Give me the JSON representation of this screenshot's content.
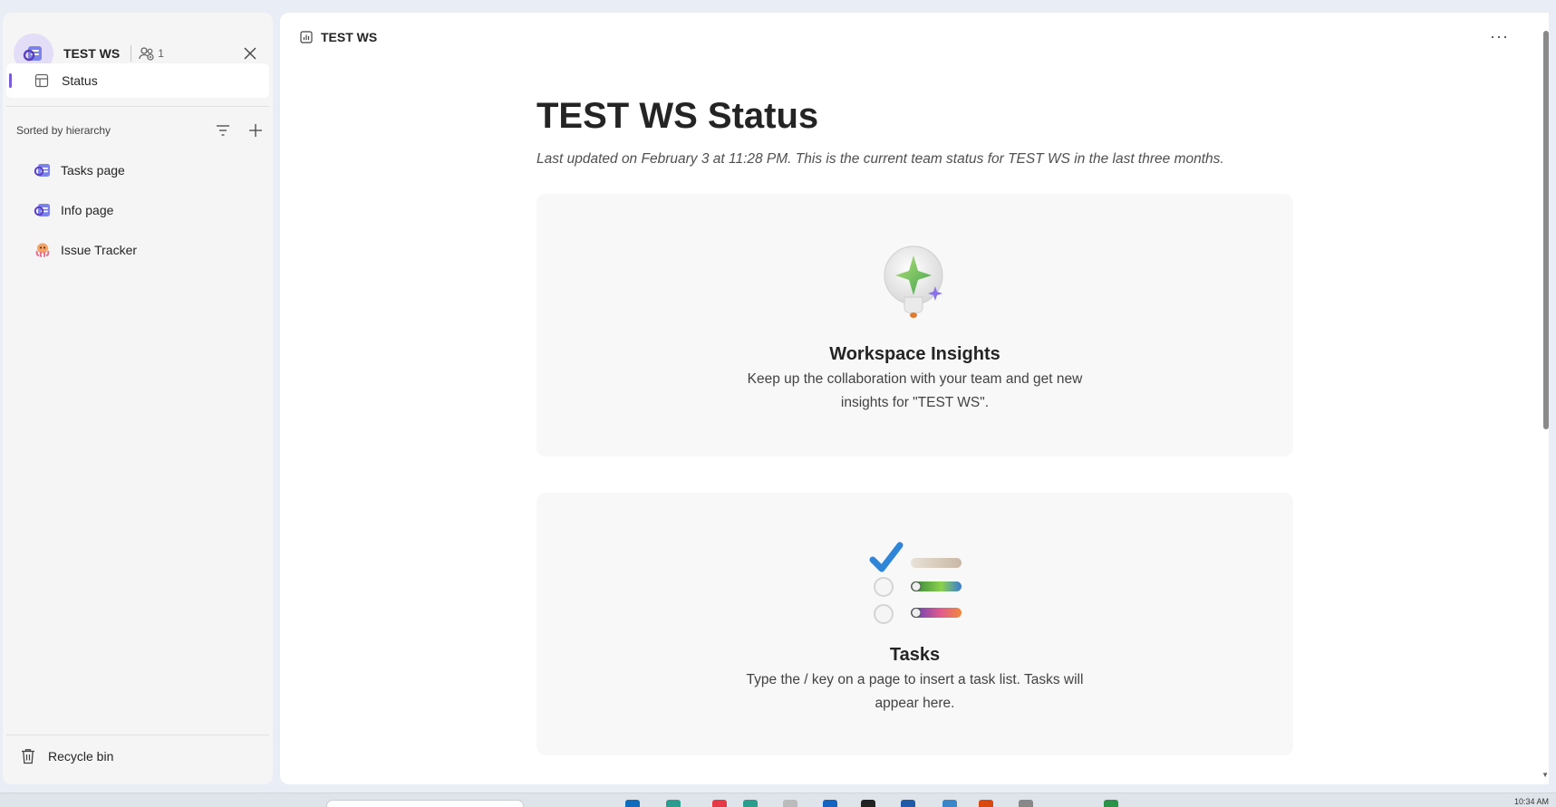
{
  "sidebar": {
    "workspace_title": "TEST WS",
    "member_count": "1",
    "status_label": "Status",
    "sort_label": "Sorted by hierarchy",
    "pages": [
      {
        "label": "Tasks page",
        "icon": "loop-page-icon"
      },
      {
        "label": "Info page",
        "icon": "loop-page-icon"
      },
      {
        "label": "Issue Tracker",
        "icon": "octopus-icon"
      }
    ],
    "recycle_label": "Recycle bin"
  },
  "main": {
    "breadcrumb": "TEST WS",
    "more_label": "···",
    "title": "TEST WS Status",
    "subtitle": "Last updated on February 3 at 11:28 PM. This is the current team status for TEST WS in the last three months.",
    "cards": [
      {
        "title": "Workspace Insights",
        "desc": "Keep up the collaboration with your team and get new insights for \"TEST WS\".",
        "icon": "lightbulb-sparkle-icon"
      },
      {
        "title": "Tasks",
        "desc": "Type the / key on a page to insert a task list. Tasks will appear here.",
        "icon": "task-list-icon"
      }
    ]
  },
  "taskbar": {
    "clock": "10:34 AM"
  },
  "colors": {
    "accent": "#7a5cd6",
    "sidebar_bg": "#f5f5f5",
    "card_bg": "#f8f8f8"
  }
}
